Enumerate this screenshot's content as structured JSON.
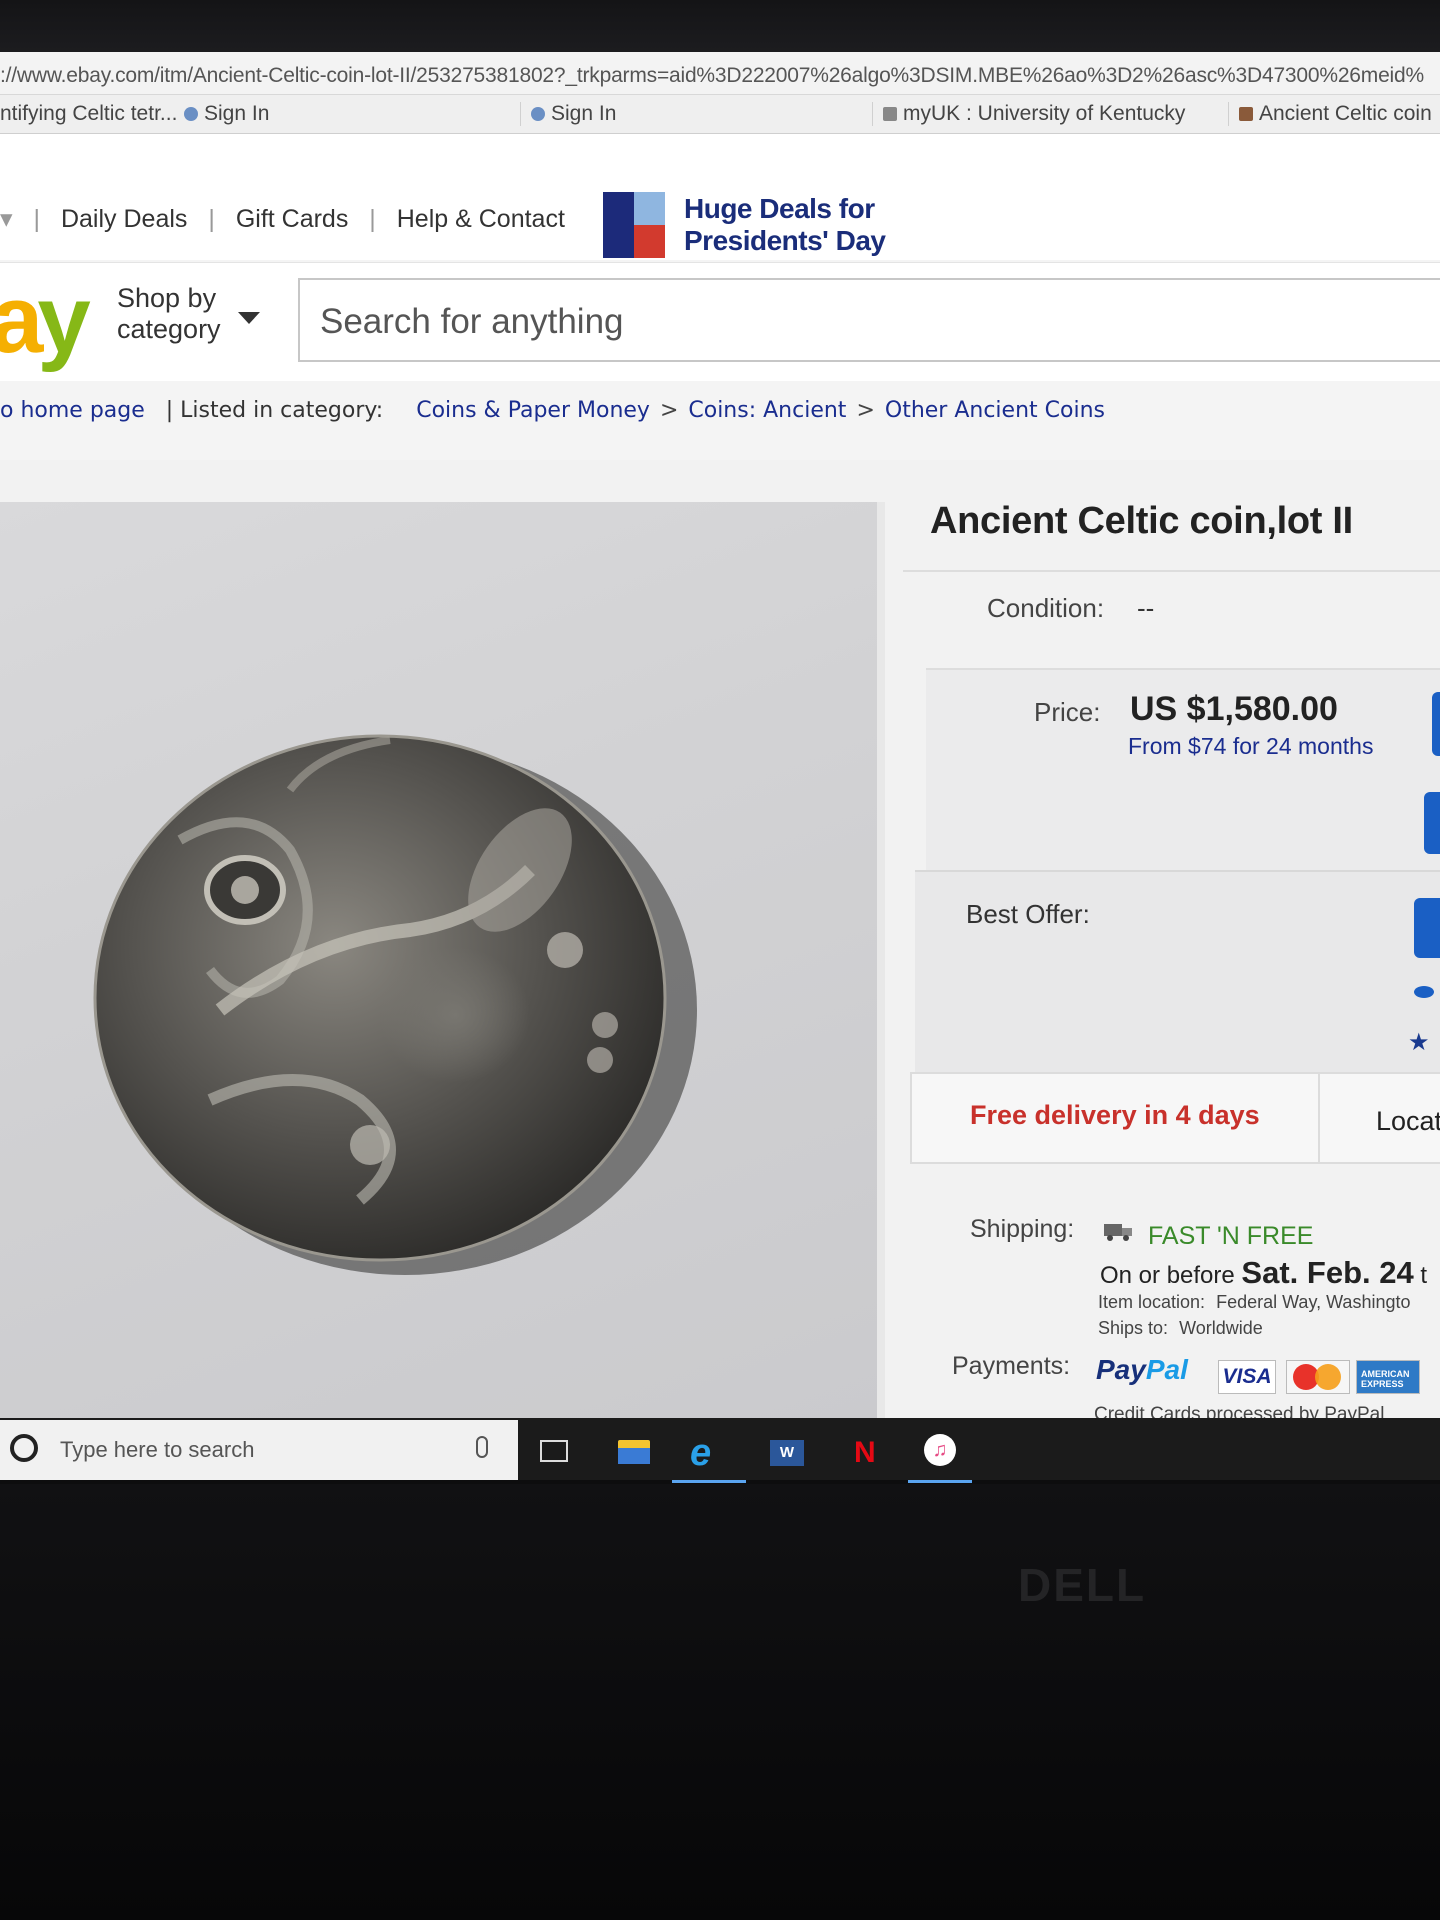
{
  "browser": {
    "url": "://www.ebay.com/itm/Ancient-Celtic-coin-lot-II/253275381802?_trkparms=aid%3D222007%26algo%3DSIM.MBE%26ao%3D2%26asc%3D47300%26meid%",
    "favorites": [
      {
        "label": "ntifying Celtic tetr..."
      },
      {
        "label": "Sign In"
      },
      {
        "label": "Sign In"
      },
      {
        "label": "myUK : University of Kentucky"
      },
      {
        "label": "Ancient Celtic coin"
      }
    ]
  },
  "topnav": {
    "daily_deals": "Daily Deals",
    "gift_cards": "Gift Cards",
    "help": "Help & Contact",
    "promo_line1": "Huge Deals for",
    "promo_line2": "Presidents' Day"
  },
  "header": {
    "logo_a": "a",
    "logo_y": "y",
    "shop_line1": "Shop by",
    "shop_line2": "category",
    "search_placeholder": "Search for anything"
  },
  "breadcrumb": {
    "back": "o home page",
    "listed": "| Listed in category:",
    "items": [
      "Coins & Paper Money",
      "Coins: Ancient",
      "Other Ancient Coins"
    ]
  },
  "item": {
    "title": "Ancient Celtic coin,lot II",
    "condition_label": "Condition:",
    "condition_value": "--",
    "price_label": "Price:",
    "price_value": "US $1,580.00",
    "price_financing": "From $74 for 24 months",
    "best_offer_label": "Best Offer:",
    "delivery": "Free delivery in 4 days",
    "location_tab": "Locat",
    "shipping_label": "Shipping:",
    "shipping_value": "FAST 'N FREE",
    "shipping_date_prefix": "On or before",
    "shipping_date": "Sat. Feb. 24",
    "shipping_date_suffix": "t",
    "item_location_label": "Item location:",
    "item_location": "Federal Way, Washingto",
    "ships_to_label": "Ships to:",
    "ships_to": "Worldwide",
    "payments_label": "Payments:",
    "paypal_1": "Pay",
    "paypal_2": "Pal",
    "visa": "VISA",
    "amex": "AMERICAN EXPRESS",
    "pay_note": "Credit Cards processed by PayPal"
  },
  "taskbar": {
    "search_placeholder": "Type here to search",
    "word": "W",
    "netflix": "N",
    "itunes": "♫"
  },
  "hardware": {
    "brand": "DELL"
  },
  "colors": {
    "ebay_blue_link": "#1a2d8f",
    "delivery_red": "#c8312b",
    "shipping_green": "#3a8a2a",
    "button_blue": "#1a5fc4"
  }
}
